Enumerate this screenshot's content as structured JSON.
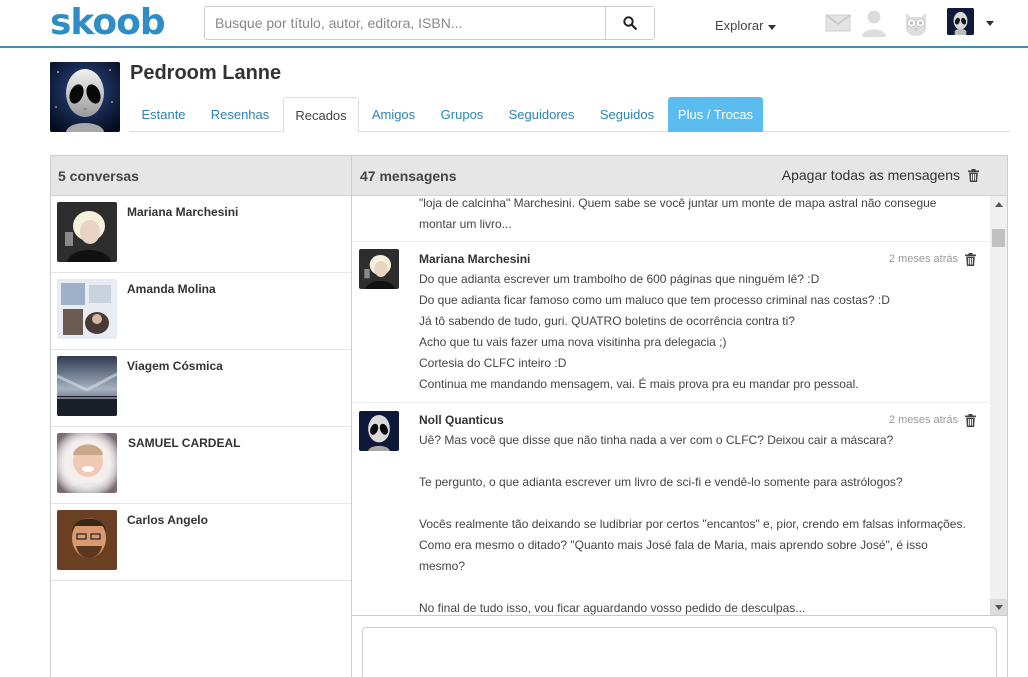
{
  "header": {
    "logo": "skoob",
    "search_placeholder": "Busque por título, autor, editora, ISBN...",
    "explore_label": "Explorar"
  },
  "profile": {
    "name": "Pedroom Lanne",
    "tabs": [
      {
        "label": "Estante"
      },
      {
        "label": "Resenhas"
      },
      {
        "label": "Recados"
      },
      {
        "label": "Amigos"
      },
      {
        "label": "Grupos"
      },
      {
        "label": "Seguidores"
      },
      {
        "label": "Seguidos"
      },
      {
        "label": "Plus / Trocas"
      }
    ],
    "active_tab": "Recados"
  },
  "conversations": {
    "header": "5 conversas",
    "items": [
      {
        "name": "Mariana Marchesini"
      },
      {
        "name": "Amanda Molina"
      },
      {
        "name": "Viagem Cósmica"
      },
      {
        "name": "SAMUEL CARDEAL"
      },
      {
        "name": "Carlos Angelo"
      }
    ]
  },
  "messages": {
    "header": "47 mensagens",
    "delete_all_label": "Apagar todas as mensagens",
    "partial_lines": [
      "\"loja de calcinha\" Marchesini. Quem sabe se você juntar um monte de mapa astral não consegue",
      "montar um livro..."
    ],
    "items": [
      {
        "author": "Mariana Marchesini",
        "time": "2 meses atrás",
        "lines": [
          "Do que adianta escrever um trambolho de 600 páginas que ninguém lê? :D",
          "Do que adianta ficar famoso como um maluco que tem processo criminal nas costas? :D",
          "Já tô sabendo de tudo, guri. QUATRO boletins de ocorrência contra ti?",
          "Acho que tu vais fazer uma nova visitinha pra delegacia ;)",
          "Cortesia do CLFC inteiro :D",
          "Continua me mandando mensagem, vai. É mais prova pra eu mandar pro pessoal."
        ]
      },
      {
        "author": "Noll Quanticus",
        "time": "2 meses atrás",
        "lines": [
          "Uê? Mas você que disse que não tinha nada a ver com o CLFC? Deixou cair a máscara?",
          "",
          "Te pergunto, o que adianta escrever um livro de sci-fi e vendê-lo somente para astrólogos?",
          "",
          "Vocês realmente tão deixando se ludibriar por certos \"encantos\" e, pior, crendo em falsas informações.",
          "Como era mesmo o ditado? \"Quanto mais José fala de Maria, mais aprendo sobre José\", é isso",
          "mesmo?",
          "",
          "No final de tudo isso, vou ficar aguardando vosso pedido de desculpas..."
        ]
      }
    ]
  },
  "colors": {
    "brand": "#2f8cc4",
    "link": "#2a83b8",
    "plus_tab": "#5bbcf0",
    "header_gray": "#e6e6e6"
  }
}
